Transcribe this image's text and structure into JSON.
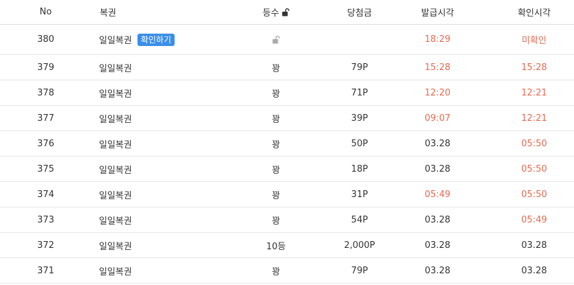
{
  "header": {
    "no": "No",
    "name": "복권",
    "rank": "등수",
    "prize": "당첨금",
    "issued": "발급시각",
    "checked": "확인시각"
  },
  "confirm_badge": "확인하기",
  "colors": {
    "accent_blue": "#3b8ee8",
    "time_red": "#e8694f"
  },
  "rows": [
    {
      "no": "380",
      "name": "일일복권",
      "rank": "",
      "prize": "",
      "issued": "18:29",
      "checked": "미확인",
      "issued_red": true,
      "checked_red": true,
      "locked": true
    },
    {
      "no": "379",
      "name": "일일복권",
      "rank": "꽝",
      "prize": "79P",
      "issued": "15:28",
      "checked": "15:28",
      "issued_red": true,
      "checked_red": true
    },
    {
      "no": "378",
      "name": "일일복권",
      "rank": "꽝",
      "prize": "71P",
      "issued": "12:20",
      "checked": "12:21",
      "issued_red": true,
      "checked_red": true
    },
    {
      "no": "377",
      "name": "일일복권",
      "rank": "꽝",
      "prize": "39P",
      "issued": "09:07",
      "checked": "12:21",
      "issued_red": true,
      "checked_red": true
    },
    {
      "no": "376",
      "name": "일일복권",
      "rank": "꽝",
      "prize": "50P",
      "issued": "03.28",
      "checked": "05:50",
      "issued_red": false,
      "checked_red": true
    },
    {
      "no": "375",
      "name": "일일복권",
      "rank": "꽝",
      "prize": "18P",
      "issued": "03.28",
      "checked": "05:50",
      "issued_red": false,
      "checked_red": true
    },
    {
      "no": "374",
      "name": "일일복권",
      "rank": "꽝",
      "prize": "31P",
      "issued": "05:49",
      "checked": "05:50",
      "issued_red": true,
      "checked_red": true
    },
    {
      "no": "373",
      "name": "일일복권",
      "rank": "꽝",
      "prize": "54P",
      "issued": "03.28",
      "checked": "05:49",
      "issued_red": false,
      "checked_red": true
    },
    {
      "no": "372",
      "name": "일일복권",
      "rank": "10등",
      "prize": "2,000P",
      "issued": "03.28",
      "checked": "03.28",
      "issued_red": false,
      "checked_red": false
    },
    {
      "no": "371",
      "name": "일일복권",
      "rank": "꽝",
      "prize": "79P",
      "issued": "03.28",
      "checked": "03.28",
      "issued_red": false,
      "checked_red": false
    }
  ]
}
